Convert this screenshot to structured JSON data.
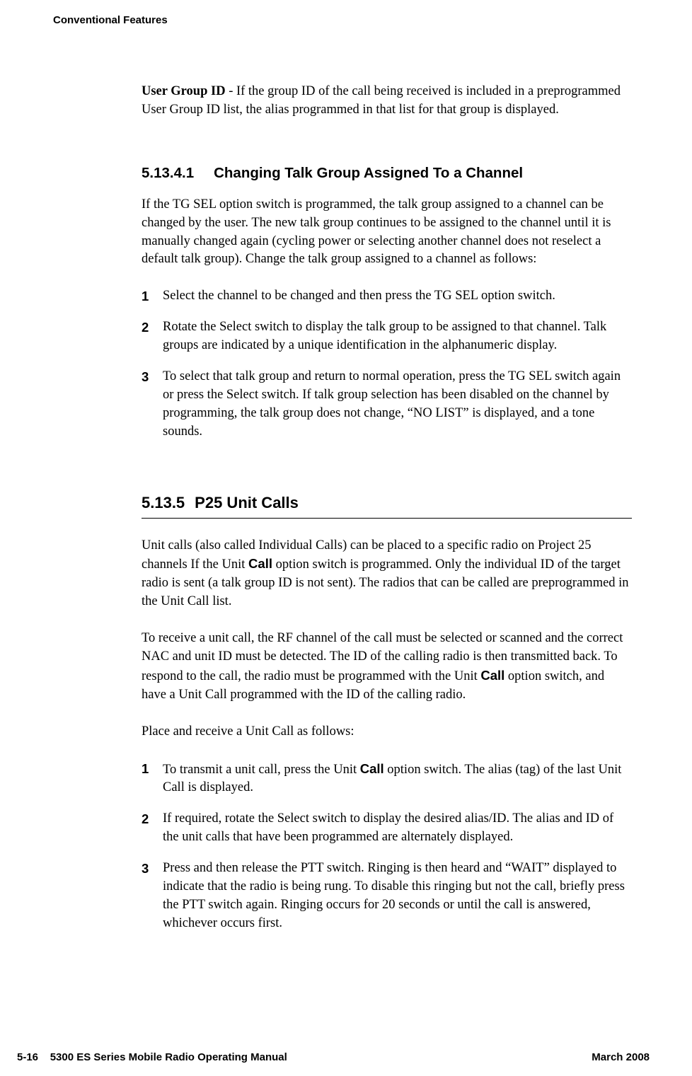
{
  "header": "Conventional Features",
  "intro": {
    "term": "User Group ID",
    "text": " - If the group ID of the call being received is included in a preprogrammed User Group ID list, the alias programmed in that list for that group is displayed."
  },
  "section_5_13_4_1": {
    "num": "5.13.4.1",
    "title": "Changing Talk Group Assigned To a Channel",
    "para": "If the TG SEL option switch is programmed, the talk group assigned to a channel can be changed by the user. The new talk group continues to be assigned to the channel until it is manually changed again (cycling power or selecting another channel does not reselect a default talk group). Change the talk group assigned to a channel as follows:",
    "steps": [
      "Select the channel to be changed and then press the TG SEL option switch.",
      "Rotate the Select switch to display the talk group to be assigned to that channel. Talk groups are indicated by a unique identification in the alphanumeric display.",
      "To select that talk group and return to normal operation, press the TG SEL switch again or press the Select switch. If talk group selection has been disabled on the channel by programming, the talk group does not change, “NO LIST” is displayed, and a tone sounds."
    ]
  },
  "section_5_13_5": {
    "num": "5.13.5",
    "title": "P25 Unit Calls",
    "para1_a": "Unit calls (also called Individual Calls) can be placed to a specific radio on Project 25 channels If the Unit ",
    "para1_bold1": "Call",
    "para1_b": " option switch is programmed. Only the individual ID of the target radio is sent (a talk group ID is not sent). The radios that can be called are preprogrammed in the Unit Call list.",
    "para2_a": "To receive a unit call, the RF channel of the call must be selected or scanned and the correct NAC and unit ID must be detected. The ID of the calling radio is then transmitted back. To respond to the call, the radio must be programmed with the Unit ",
    "para2_bold1": "Call",
    "para2_b": " option switch, and have a Unit Call programmed with the ID of the calling radio.",
    "para3": "Place and receive a Unit Call as follows:",
    "steps": [
      {
        "a": "To transmit a unit call, press the Unit ",
        "bold": "Call",
        "b": " option switch. The alias (tag) of the last Unit Call is displayed."
      },
      {
        "a": "If required, rotate the Select switch to display the desired alias/ID. The alias and ID of the unit calls that have been programmed are alternately displayed.",
        "bold": "",
        "b": ""
      },
      {
        "a": "Press and then release the PTT switch. Ringing is then heard and “WAIT” displayed to indicate that the radio is being rung. To disable this ringing but not the call, briefly press the PTT switch again. Ringing occurs for 20 seconds or until the call is answered, whichever occurs first.",
        "bold": "",
        "b": ""
      }
    ]
  },
  "footer": {
    "left": "5-16    5300 ES Series Mobile Radio Operating Manual",
    "right": "March 2008"
  },
  "nums": [
    "1",
    "2",
    "3"
  ]
}
